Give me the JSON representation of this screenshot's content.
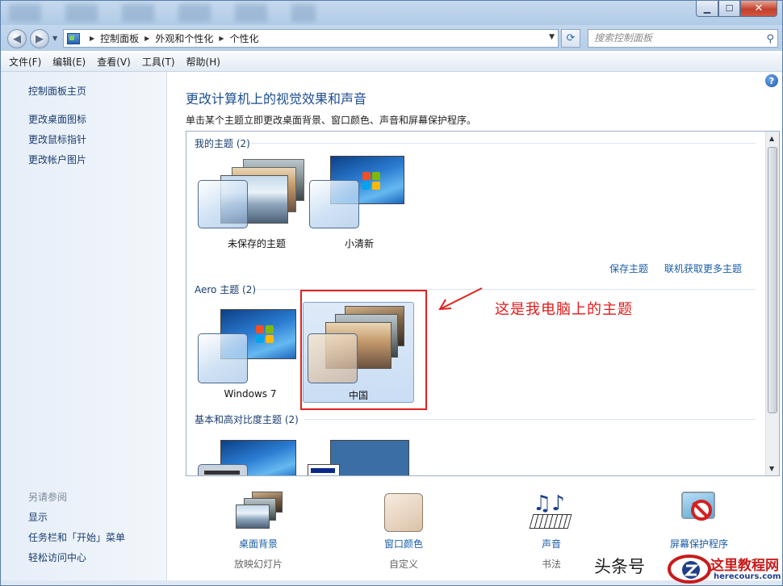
{
  "window": {
    "min": "▁",
    "max": "☐",
    "close": "✕"
  },
  "nav": {
    "back": "◀",
    "forward": "▶",
    "refresh": "⟳",
    "breadcrumbs": [
      "控制面板",
      "外观和个性化",
      "个性化"
    ],
    "search_placeholder": "搜索控制面板"
  },
  "menu": [
    "文件(F)",
    "编辑(E)",
    "查看(V)",
    "工具(T)",
    "帮助(H)"
  ],
  "left": {
    "home": "控制面板主页",
    "links": [
      "更改桌面图标",
      "更改鼠标指针",
      "更改帐户图片"
    ],
    "see_also": "另请参阅",
    "see_links": [
      "显示",
      "任务栏和「开始」菜单",
      "轻松访问中心"
    ]
  },
  "main": {
    "help": "?",
    "title": "更改计算机上的视觉效果和声音",
    "subtitle": "单击某个主题立即更改桌面背景、窗口颜色、声音和屏幕保护程序。",
    "my_themes": "我的主题 (2)",
    "my_theme_tiles": [
      "未保存的主题",
      "小清新"
    ],
    "save_theme": "保存主题",
    "get_more": "联机获取更多主题",
    "aero_themes": "Aero 主题 (2)",
    "aero_tiles": [
      "Windows 7",
      "中国"
    ],
    "basic_themes": "基本和高对比度主题 (2)"
  },
  "annotation": "这是我电脑上的主题",
  "bottom": [
    {
      "title": "桌面背景",
      "sub": "放映幻灯片",
      "icon": "desktop-background-icon"
    },
    {
      "title": "窗口颜色",
      "sub": "自定义",
      "icon": "window-color-icon"
    },
    {
      "title": "声音",
      "sub": "书法",
      "icon": "sound-icon"
    },
    {
      "title": "屏幕保护程序",
      "sub": "",
      "icon": "screensaver-icon"
    }
  ],
  "watermark": {
    "toutiao": "头条号",
    "site": "这里教程网",
    "url": "herecours.com"
  }
}
